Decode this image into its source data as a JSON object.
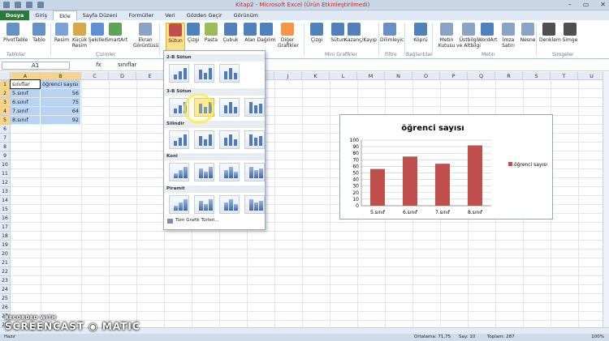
{
  "window": {
    "title": "Kitap2 - Microsoft Excel (Ürün Etkinleştirilmedi)",
    "controls": [
      "–",
      "▭",
      "✕"
    ]
  },
  "tabs": [
    "Dosya",
    "Giriş",
    "Ekle",
    "Sayfa Düzeni",
    "Formüller",
    "Veri",
    "Gözden Geçir",
    "Görünüm"
  ],
  "active_tab": "Ekle",
  "ribbon": {
    "buttons": [
      {
        "label": "PivotTable",
        "icon": "pivottable-icon",
        "color": "#6a8fc7"
      },
      {
        "label": "Tablo",
        "icon": "table-icon",
        "color": "#6a8fc7"
      },
      {
        "label": "Resim",
        "icon": "picture-icon",
        "color": "#7aa2d6"
      },
      {
        "label": "Küçük Resim",
        "icon": "clipart-icon",
        "color": "#d7a84a"
      },
      {
        "label": "Şekiller",
        "icon": "shapes-icon",
        "color": "#5f8fd0"
      },
      {
        "label": "SmartArt",
        "icon": "smartart-icon",
        "color": "#5ba35b"
      },
      {
        "label": "Ekran Görüntüsü",
        "icon": "screenshot-icon",
        "color": "#8ba3c4"
      },
      {
        "label": "Sütun",
        "icon": "column-chart-icon",
        "color": "#c0504d"
      },
      {
        "label": "Çizgi",
        "icon": "line-chart-icon",
        "color": "#4f81bd"
      },
      {
        "label": "Pasta",
        "icon": "pie-chart-icon",
        "color": "#9bbb59"
      },
      {
        "label": "Çubuk",
        "icon": "bar-chart-icon",
        "color": "#4f81bd"
      },
      {
        "label": "Alan",
        "icon": "area-chart-icon",
        "color": "#4f81bd"
      },
      {
        "label": "Dağılım",
        "icon": "scatter-chart-icon",
        "color": "#4f81bd"
      },
      {
        "label": "Diğer Grafikler",
        "icon": "other-charts-icon",
        "color": "#f79646"
      },
      {
        "label": "Çizgi",
        "icon": "sparkline-line-icon",
        "color": "#4f81bd"
      },
      {
        "label": "Sütun",
        "icon": "sparkline-column-icon",
        "color": "#4f81bd"
      },
      {
        "label": "Kazanç/Kayıp",
        "icon": "winloss-icon",
        "color": "#4f81bd"
      },
      {
        "label": "Dilimleyici",
        "icon": "slicer-icon",
        "color": "#6a8fc7"
      },
      {
        "label": "Köprü",
        "icon": "hyperlink-icon",
        "color": "#4f81bd"
      },
      {
        "label": "Metin Kutusu",
        "icon": "textbox-icon",
        "color": "#8ba3c4"
      },
      {
        "label": "Üstbilgi ve Altbilgi",
        "icon": "header-footer-icon",
        "color": "#8ba3c4"
      },
      {
        "label": "WordArt",
        "icon": "wordart-icon",
        "color": "#4f81bd"
      },
      {
        "label": "İmza Satırı",
        "icon": "signature-icon",
        "color": "#8ba3c4"
      },
      {
        "label": "Nesne",
        "icon": "object-icon",
        "color": "#8ba3c4"
      },
      {
        "label": "Denklem",
        "icon": "equation-icon",
        "color": "#4f4f4f"
      },
      {
        "label": "Simge",
        "icon": "symbol-icon",
        "color": "#4f4f4f"
      }
    ],
    "groups": [
      "Tablolar",
      "Çizimler",
      "Mini Grafikler",
      "Filtre",
      "Bağlantılar",
      "Metin",
      "Simgeler"
    ]
  },
  "formula_bar": {
    "cell": "A1",
    "fx": "fx",
    "value": "sınıflar"
  },
  "sheet": {
    "columns": [
      "A",
      "B",
      "C",
      "D",
      "E",
      "F",
      "G",
      "H",
      "I",
      "J",
      "K",
      "L",
      "M",
      "N",
      "O",
      "P",
      "Q",
      "R",
      "S",
      "T",
      "U"
    ],
    "rows": [
      "1",
      "2",
      "3",
      "4",
      "5",
      "6",
      "7",
      "8",
      "9",
      "10",
      "11",
      "12",
      "13",
      "14",
      "15",
      "16",
      "17",
      "18",
      "19",
      "20",
      "21",
      "22",
      "23",
      "24",
      "25",
      "26",
      "27",
      "28"
    ],
    "header": [
      "sınıflar",
      "öğrenci sayısı"
    ],
    "data": [
      [
        "5.sınıf",
        "56"
      ],
      [
        "6.sınıf",
        "75"
      ],
      [
        "7.sınıf",
        "64"
      ],
      [
        "8.sınıf",
        "92"
      ]
    ]
  },
  "dropdown": {
    "sections": [
      "2-B Sütun",
      "3-B Sütun",
      "Silindir",
      "Koni",
      "Piramit"
    ],
    "all_types": "Tüm Grafik Türleri..."
  },
  "chart_data": {
    "type": "bar",
    "title": "öğrenci sayısı",
    "categories": [
      "5.sınıf",
      "6.sınıf",
      "7.sınıf",
      "8.sınıf"
    ],
    "series": [
      {
        "name": "öğrenci sayısı",
        "values": [
          56,
          75,
          64,
          92
        ],
        "color": "#c0504d"
      }
    ],
    "ylim": [
      0,
      100
    ],
    "yticks": [
      "0",
      "10",
      "20",
      "30",
      "40",
      "50",
      "60",
      "70",
      "80",
      "90",
      "100"
    ],
    "grid": true,
    "legend": "right"
  },
  "status": {
    "ready": "Hazır",
    "average": "Ortalama: 71,75",
    "count": "Say: 10",
    "sum": "Toplam: 287",
    "zoom": "100%"
  },
  "watermark": {
    "line1": "RECORDED WITH",
    "line2": "SCREENCAST ◉ MATIC"
  }
}
